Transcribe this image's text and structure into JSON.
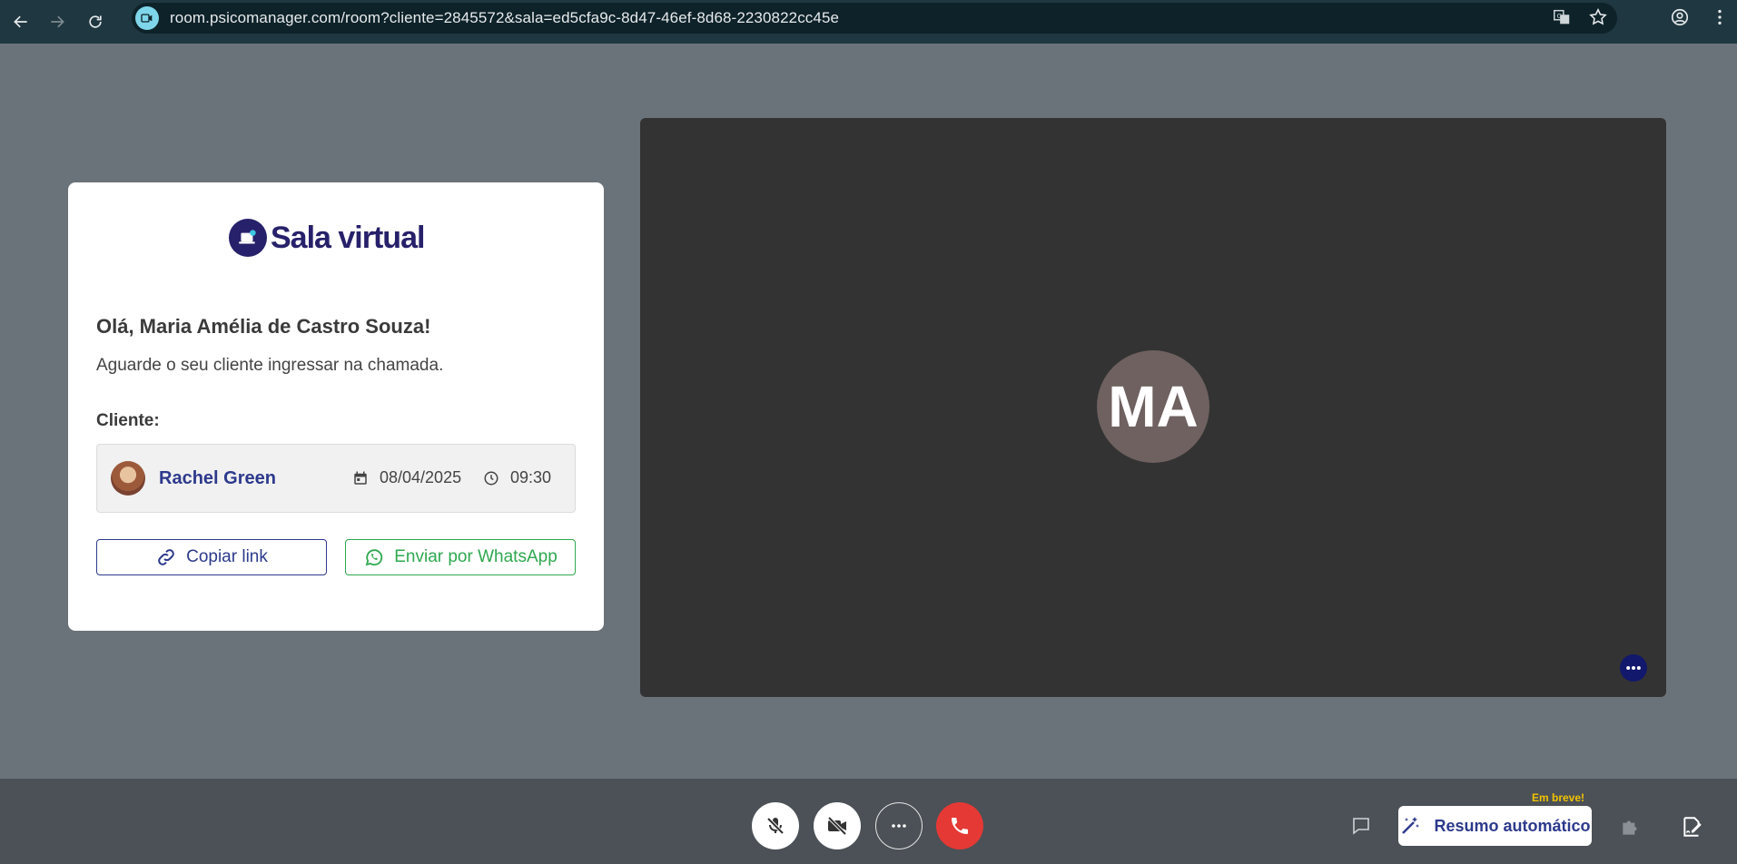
{
  "browser": {
    "url": "room.psicomanager.com/room?cliente=2845572&sala=ed5cfa9c-8d47-46ef-8d68-2230822cc45e",
    "icons": [
      "back-icon",
      "forward-icon",
      "reload-icon",
      "site-icon",
      "translate-icon",
      "star-icon",
      "profile-icon",
      "menu-icon"
    ]
  },
  "card": {
    "logo_text": "Sala virtual",
    "greeting": "Olá, Maria Amélia de Castro Souza!",
    "subtext": "Aguarde o seu cliente ingressar na chamada.",
    "client_label": "Cliente:",
    "client": {
      "name": "Rachel Green",
      "date": "08/04/2025",
      "time": "09:30"
    },
    "copy_link_label": "Copiar link",
    "whatsapp_label": "Enviar por WhatsApp"
  },
  "video": {
    "initials": "MA"
  },
  "toolbar": {
    "resumo_label": "Resumo automático",
    "em_breve": "Em breve!"
  },
  "colors": {
    "brand": "#27216b",
    "accent": "#2d3a8c",
    "whatsapp": "#2fa84f",
    "hangup": "#e53935",
    "page_bg": "#6b737a",
    "toolbar_bg": "#4b5156",
    "video_bg": "#333333"
  }
}
